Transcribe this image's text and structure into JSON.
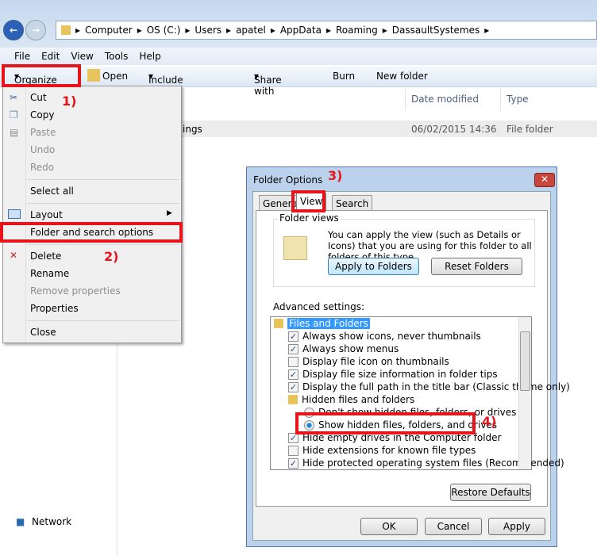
{
  "explorer": {
    "breadcrumb": [
      "Computer",
      "OS (C:)",
      "Users",
      "apatel",
      "AppData",
      "Roaming",
      "DassaultSystemes"
    ],
    "menubar": [
      "File",
      "Edit",
      "View",
      "Tools",
      "Help"
    ],
    "toolbar": {
      "organize": "Organize",
      "open": "Open",
      "include": "Include in library",
      "share": "Share with",
      "burn": "Burn",
      "new_folder": "New folder"
    },
    "columns": {
      "date": "Date modified",
      "type": "Type"
    },
    "row": {
      "name": "ings",
      "date": "06/02/2015 14:36",
      "type": "File folder"
    },
    "nav_network": "Network"
  },
  "organize_menu": {
    "cut": "Cut",
    "copy": "Copy",
    "paste": "Paste",
    "undo": "Undo",
    "redo": "Redo",
    "select_all": "Select all",
    "layout": "Layout",
    "folder_options": "Folder and search options",
    "delete": "Delete",
    "rename": "Rename",
    "remove_props": "Remove properties",
    "properties": "Properties",
    "close": "Close"
  },
  "annotations": [
    "1)",
    "2)",
    "3)",
    "4)"
  ],
  "dialog": {
    "title": "Folder Options",
    "tabs": [
      "General",
      "View",
      "Search"
    ],
    "folder_views": "Folder views",
    "folder_views_desc": "You can apply the view (such as Details or Icons) that you are using for this folder to all folders of this type.",
    "apply_folders": "Apply to Folders",
    "reset_folders": "Reset Folders",
    "advanced": "Advanced settings:",
    "tree": [
      {
        "label": "Files and Folders",
        "kind": "folder"
      },
      {
        "label": "Always show icons, never thumbnails",
        "kind": "check",
        "checked": true
      },
      {
        "label": "Always show menus",
        "kind": "check",
        "checked": true
      },
      {
        "label": "Display file icon on thumbnails",
        "kind": "check",
        "checked": false
      },
      {
        "label": "Display file size information in folder tips",
        "kind": "check",
        "checked": true
      },
      {
        "label": "Display the full path in the title bar (Classic theme only)",
        "kind": "check",
        "checked": true
      },
      {
        "label": "Hidden files and folders",
        "kind": "folder"
      },
      {
        "label": "Don't show hidden files, folders, or drives",
        "kind": "radio",
        "checked": false
      },
      {
        "label": "Show hidden files, folders, and drives",
        "kind": "radio",
        "checked": true
      },
      {
        "label": "Hide empty drives in the Computer folder",
        "kind": "check",
        "checked": true
      },
      {
        "label": "Hide extensions for known file types",
        "kind": "check",
        "checked": false
      },
      {
        "label": "Hide protected operating system files (Recommended)",
        "kind": "check",
        "checked": true
      }
    ],
    "restore": "Restore Defaults",
    "ok": "OK",
    "cancel": "Cancel",
    "apply": "Apply"
  }
}
